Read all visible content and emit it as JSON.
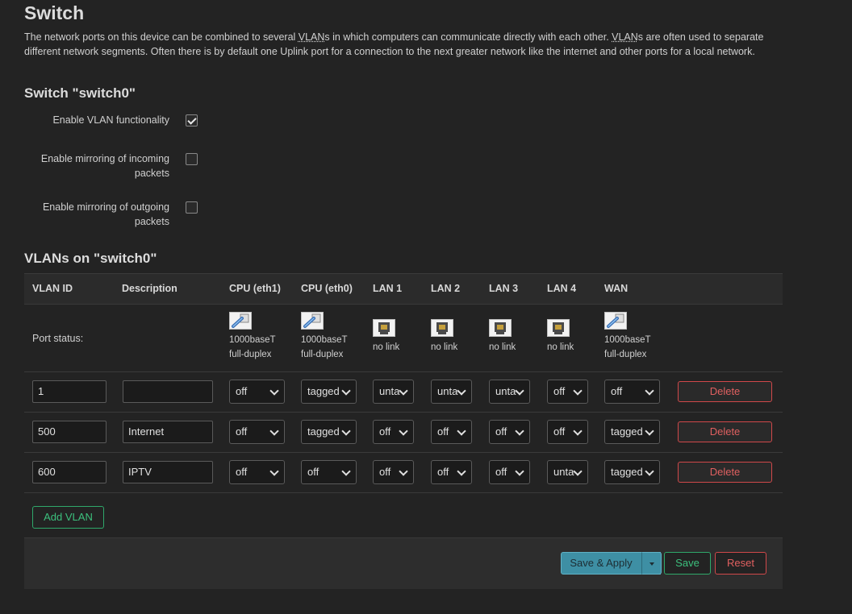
{
  "page": {
    "title": "Switch",
    "description_parts": [
      "The network ports on this device can be combined to several ",
      "VLAN",
      "s in which computers can communicate directly with each other. ",
      "VLAN",
      "s are often used to separate different network segments. Often there is by default one Uplink port for a connection to the next greater network like the internet and other ports for a local network."
    ]
  },
  "switch_section": {
    "title": "Switch \"switch0\"",
    "options": [
      {
        "label": "Enable VLAN functionality",
        "checked": true
      },
      {
        "label": "Enable mirroring of incoming packets",
        "checked": false
      },
      {
        "label": "Enable mirroring of outgoing packets",
        "checked": false
      }
    ]
  },
  "vlan_section": {
    "title": "VLANs on \"switch0\"",
    "headers": [
      "VLAN ID",
      "Description",
      "CPU (eth1)",
      "CPU (eth0)",
      "LAN 1",
      "LAN 2",
      "LAN 3",
      "LAN 4",
      "WAN"
    ],
    "port_status_label": "Port status:",
    "port_status": [
      {
        "icon": "port-connected-icon",
        "line1": "1000baseT",
        "line2": "full-duplex"
      },
      {
        "icon": "port-connected-icon",
        "line1": "1000baseT",
        "line2": "full-duplex"
      },
      {
        "icon": "port-disconnected-icon",
        "line1": "no link",
        "line2": ""
      },
      {
        "icon": "port-disconnected-icon",
        "line1": "no link",
        "line2": ""
      },
      {
        "icon": "port-disconnected-icon",
        "line1": "no link",
        "line2": ""
      },
      {
        "icon": "port-disconnected-icon",
        "line1": "no link",
        "line2": ""
      },
      {
        "icon": "port-connected-icon",
        "line1": "1000baseT",
        "line2": "full-duplex"
      }
    ],
    "rows": [
      {
        "vlan_id": "1",
        "description": "",
        "ports": [
          "off",
          "tagged",
          "untagged",
          "untagged",
          "untagged",
          "off",
          "off"
        ]
      },
      {
        "vlan_id": "500",
        "description": "Internet",
        "ports": [
          "off",
          "tagged",
          "off",
          "off",
          "off",
          "off",
          "tagged"
        ]
      },
      {
        "vlan_id": "600",
        "description": "IPTV",
        "ports": [
          "off",
          "off",
          "off",
          "off",
          "off",
          "untagged",
          "tagged"
        ]
      }
    ],
    "delete_label": "Delete",
    "add_label": "Add VLAN"
  },
  "actions": {
    "save_apply": "Save & Apply",
    "save": "Save",
    "reset": "Reset"
  },
  "colors": {
    "background": "#232323",
    "accent_blue": "#3e8fa4",
    "positive_green": "#3cc07d",
    "negative_red": "#e06060"
  }
}
